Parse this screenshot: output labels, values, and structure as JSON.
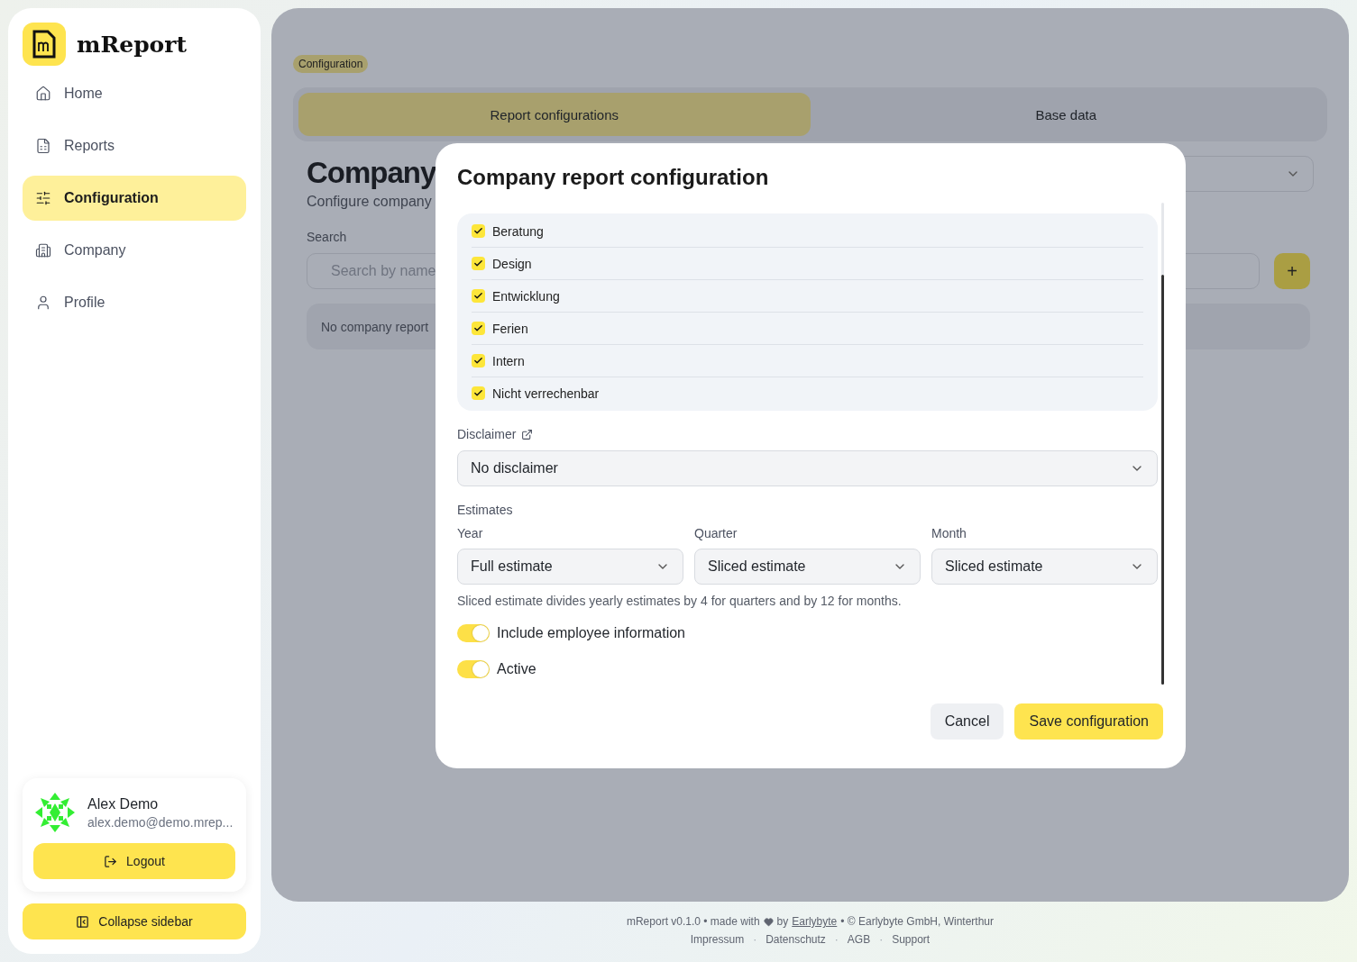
{
  "sidebar": {
    "brand": "mReport",
    "nav": [
      {
        "label": "Home",
        "selected": false
      },
      {
        "label": "Reports",
        "selected": false
      },
      {
        "label": "Configuration",
        "selected": true
      },
      {
        "label": "Company",
        "selected": false
      },
      {
        "label": "Profile",
        "selected": false
      }
    ],
    "user": {
      "name": "Alex Demo",
      "email": "alex.demo@demo.mrep..."
    },
    "logout": "Logout",
    "collapse": "Collapse sidebar"
  },
  "page": {
    "breadcrumb": "Configuration",
    "tabs": [
      {
        "label": "Report configurations",
        "selected": true
      },
      {
        "label": "Base data",
        "selected": false
      }
    ],
    "heading": "Company",
    "subtitle": "Configure company",
    "search_label": "Search",
    "search_placeholder": "Search by name",
    "add_button": "+",
    "empty": "No company report"
  },
  "modal": {
    "title": "Company report configuration",
    "services": [
      {
        "label": "Beratung",
        "checked": true
      },
      {
        "label": "Design",
        "checked": true
      },
      {
        "label": "Entwicklung",
        "checked": true
      },
      {
        "label": "Ferien",
        "checked": true
      },
      {
        "label": "Intern",
        "checked": true
      },
      {
        "label": "Nicht verrechenbar",
        "checked": true
      }
    ],
    "disclaimer": {
      "label": "Disclaimer",
      "value": "No disclaimer"
    },
    "estimates": {
      "label": "Estimates",
      "fields": [
        {
          "label": "Year",
          "value": "Full estimate"
        },
        {
          "label": "Quarter",
          "value": "Sliced estimate"
        },
        {
          "label": "Month",
          "value": "Sliced estimate"
        }
      ],
      "note": "Sliced estimate divides yearly estimates by 4 for quarters and by 12 for months."
    },
    "toggles": [
      {
        "label": "Include employee information",
        "on": true
      },
      {
        "label": "Active",
        "on": true
      }
    ],
    "cancel": "Cancel",
    "save": "Save configuration"
  },
  "footer": {
    "version": "mReport v0.1.0 • made with",
    "by": "by",
    "author_link": "Earlybyte",
    "copyright": "• © Earlybyte GmbH, Winterthur",
    "separator": "·",
    "links": [
      "Impressum",
      "Datenschutz",
      "AGB",
      "Support"
    ]
  }
}
